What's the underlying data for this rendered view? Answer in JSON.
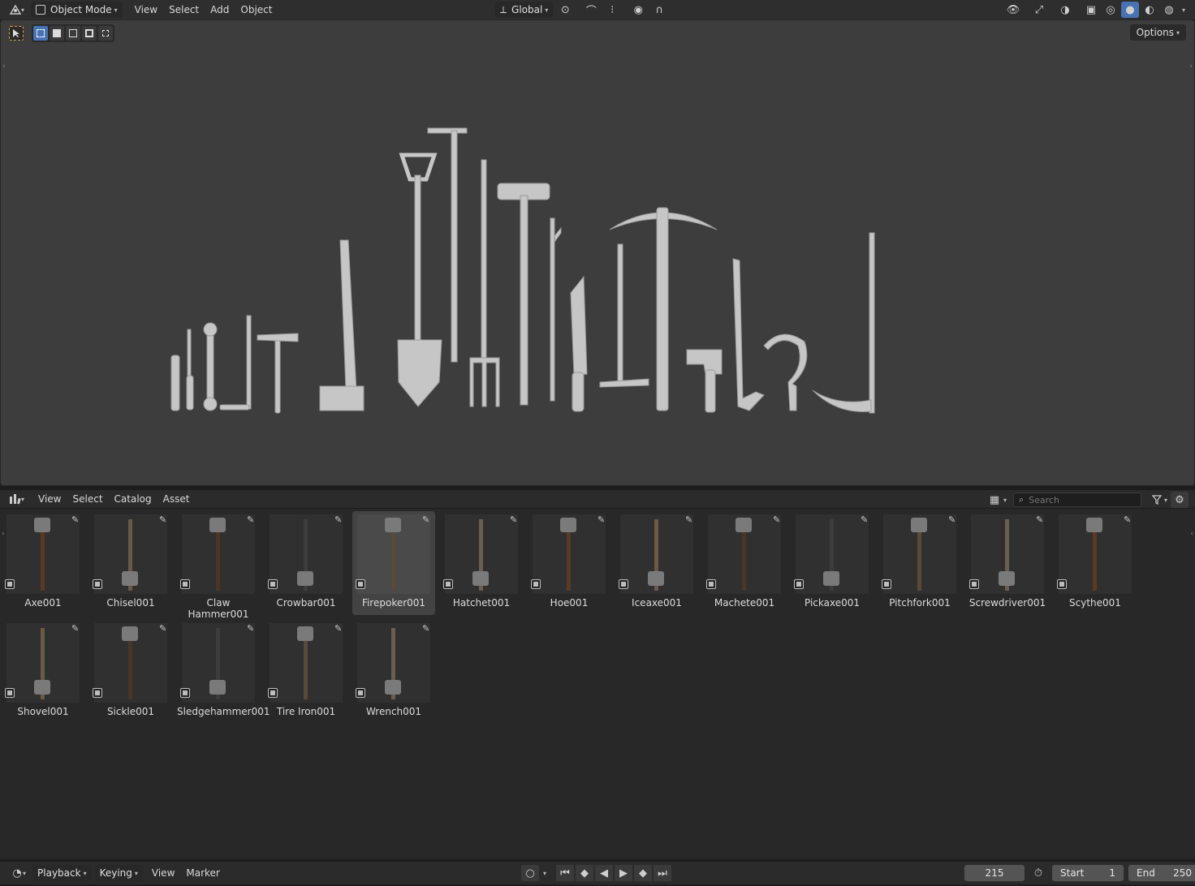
{
  "viewport_header": {
    "mode_label": "Object Mode",
    "menus": [
      "View",
      "Select",
      "Add",
      "Object"
    ],
    "orientation_label": "Global"
  },
  "viewport": {
    "options_label": "Options"
  },
  "asset_header": {
    "menus": [
      "View",
      "Select",
      "Catalog",
      "Asset"
    ],
    "search_placeholder": "Search"
  },
  "assets": [
    {
      "name": "Axe001",
      "selected": false
    },
    {
      "name": "Chisel001",
      "selected": false
    },
    {
      "name": "Claw Hammer001",
      "selected": false
    },
    {
      "name": "Crowbar001",
      "selected": false
    },
    {
      "name": "Firepoker001",
      "selected": true
    },
    {
      "name": "Hatchet001",
      "selected": false
    },
    {
      "name": "Hoe001",
      "selected": false
    },
    {
      "name": "Iceaxe001",
      "selected": false
    },
    {
      "name": "Machete001",
      "selected": false
    },
    {
      "name": "Pickaxe001",
      "selected": false
    },
    {
      "name": "Pitchfork001",
      "selected": false
    },
    {
      "name": "Screwdriver001",
      "selected": false
    },
    {
      "name": "Scythe001",
      "selected": false
    },
    {
      "name": "Shovel001",
      "selected": false
    },
    {
      "name": "Sickle001",
      "selected": false
    },
    {
      "name": "Sledgehammer001",
      "selected": false
    },
    {
      "name": "Tire Iron001",
      "selected": false
    },
    {
      "name": "Wrench001",
      "selected": false
    }
  ],
  "timeline": {
    "menus": [
      "Playback",
      "Keying",
      "View",
      "Marker"
    ],
    "current_frame": "215",
    "start_label": "Start",
    "start_value": "1",
    "end_label": "End",
    "end_value": "250"
  },
  "colors": {
    "accent": "#4772b3",
    "viewport_bg": "#3d3d3d",
    "model_gray": "#c8c8c8"
  }
}
